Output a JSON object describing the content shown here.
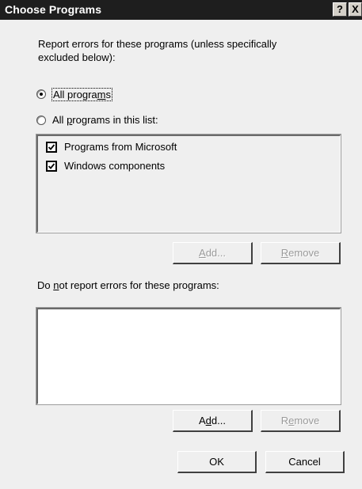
{
  "window": {
    "title": "Choose Programs",
    "help_glyph": "?",
    "close_glyph": "X"
  },
  "report_section": {
    "description_line1": "Report errors for these programs (unless specifically",
    "description_line2": "excluded below):",
    "radio_all_programs": {
      "label_before": "All progra",
      "label_mnemonic": "m",
      "label_after": "s",
      "selected": true
    },
    "radio_list_programs": {
      "label_before": "All ",
      "label_mnemonic": "p",
      "label_after": "rograms in this list:",
      "selected": false
    },
    "included_list": [
      {
        "label": "Programs from Microsoft",
        "checked": true
      },
      {
        "label": "Windows components",
        "checked": true
      }
    ],
    "add_button": {
      "label_before": "",
      "label_mnemonic": "A",
      "label_after": "dd...",
      "enabled": false
    },
    "remove_button": {
      "label_before": "",
      "label_mnemonic": "R",
      "label_after": "emove",
      "enabled": false
    }
  },
  "exclude_section": {
    "heading_before": "Do ",
    "heading_mnemonic": "n",
    "heading_after": "ot report errors for these programs:",
    "excluded_list": [],
    "add_button": {
      "label_before": "A",
      "label_mnemonic": "d",
      "label_after": "d...",
      "enabled": true
    },
    "remove_button": {
      "label_before": "R",
      "label_mnemonic": "e",
      "label_after": "move",
      "enabled": false
    }
  },
  "footer": {
    "ok_label": "OK",
    "cancel_label": "Cancel"
  },
  "icons": {
    "check": "checkmark-icon",
    "radio_dot": "radio-dot-icon"
  },
  "colors": {
    "titlebar": "#1e1e1e",
    "dialog_face": "#efefef",
    "disabled_text": "#9a9a9a"
  }
}
